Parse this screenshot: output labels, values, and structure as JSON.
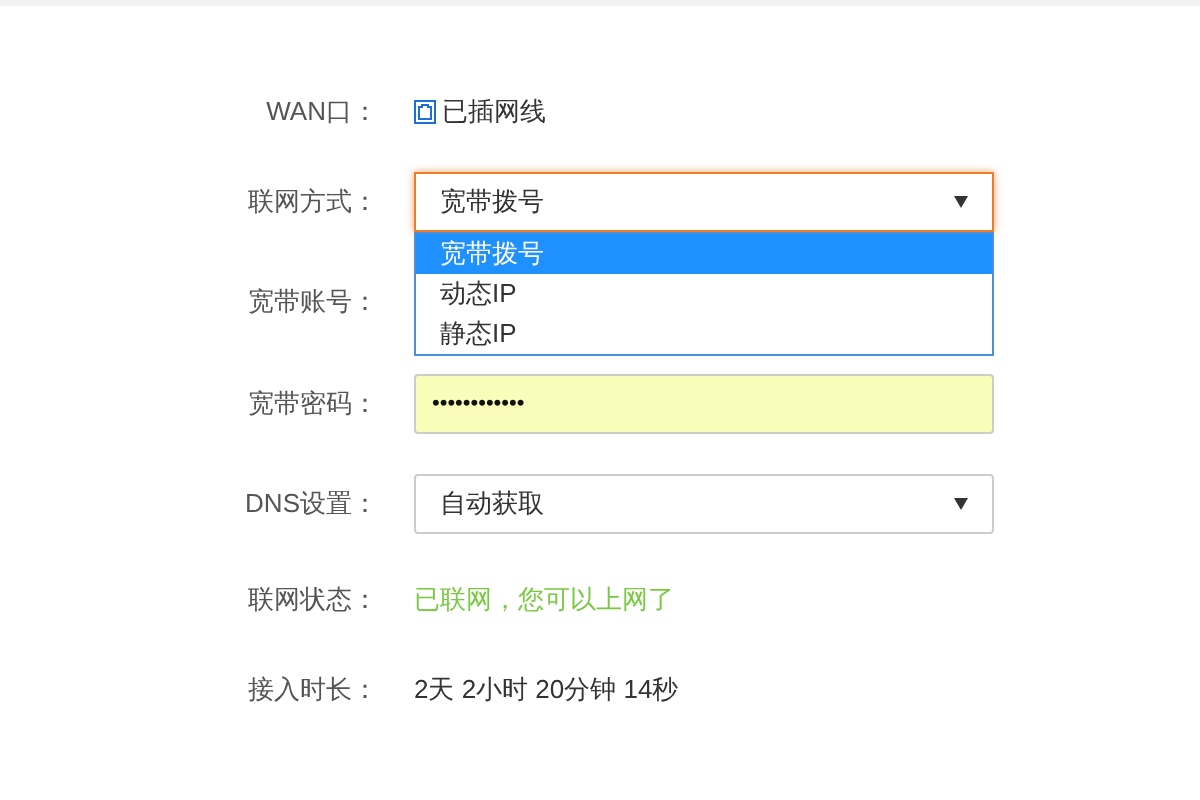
{
  "rows": [
    {
      "kind": "status",
      "label": "WAN口：",
      "value": "已插网线"
    },
    {
      "kind": "select",
      "label": "联网方式：",
      "value": "宽带拨号",
      "open": true,
      "focused": true,
      "options": [
        {
          "label": "宽带拨号",
          "selected": true
        },
        {
          "label": "动态IP",
          "selected": false
        },
        {
          "label": "静态IP",
          "selected": false
        }
      ]
    },
    {
      "kind": "input",
      "label": "宽带账号："
    },
    {
      "kind": "password",
      "label": "宽带密码：",
      "value": "••••••••••••"
    },
    {
      "kind": "select",
      "label": "DNS设置：",
      "value": "自动获取"
    },
    {
      "kind": "ok_text",
      "label": "联网状态：",
      "value": "已联网，您可以上网了"
    },
    {
      "kind": "text",
      "label": "接入时长：",
      "value": "2天 2小时 20分钟 14秒"
    }
  ]
}
